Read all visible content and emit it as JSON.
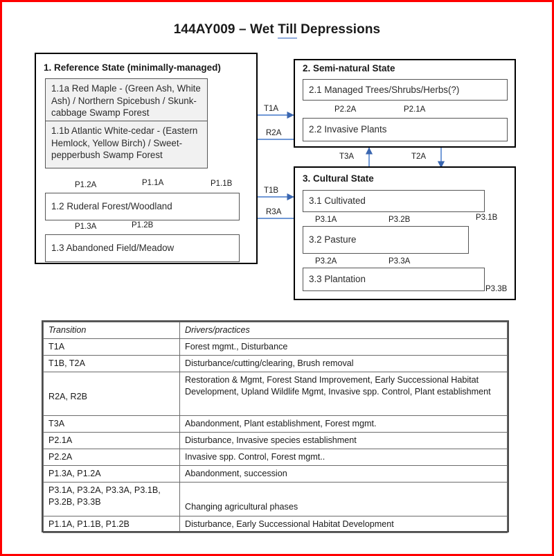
{
  "page": {
    "title_prefix": "144AY009 – Wet ",
    "title_misspelled": "Till",
    "title_suffix": " Depressions",
    "frame_color": "#FF0000",
    "arrow_color": "#4472C4"
  },
  "states": [
    {
      "id": "state-1",
      "title": "1.  Reference State (minimally-managed)",
      "phases": [
        {
          "id": "1.1a",
          "label": "1.1a Red Maple - (Green Ash, White Ash) / Northern Spicebush / Skunk-cabbage Swamp Forest"
        },
        {
          "id": "1.1b",
          "label": "1.1b Atlantic White-cedar - (Eastern Hemlock, Yellow Birch) / Sweet-pepperbush Swamp Forest"
        },
        {
          "id": "1.2",
          "label": "1.2  Ruderal Forest/Woodland"
        },
        {
          "id": "1.3",
          "label": "1.3  Abandoned Field/Meadow"
        }
      ]
    },
    {
      "id": "state-2",
      "title": "2.  Semi-natural State",
      "phases": [
        {
          "id": "2.1",
          "label": "2.1  Managed Trees/Shrubs/Herbs(?)"
        },
        {
          "id": "2.2",
          "label": "2.2  Invasive Plants"
        }
      ]
    },
    {
      "id": "state-3",
      "title": "3.  Cultural State",
      "phases": [
        {
          "id": "3.1",
          "label": "3.1  Cultivated"
        },
        {
          "id": "3.2",
          "label": "3.2  Pasture"
        },
        {
          "id": "3.3",
          "label": "3.3  Plantation"
        }
      ]
    }
  ],
  "arrow_labels": {
    "p12a": "P1.2A",
    "p11a": "P1.1A",
    "p11b": "P1.1B",
    "p13a": "P1.3A",
    "p12b": "P1.2B",
    "t1a": "T1A",
    "r2a": "R2A",
    "t1b": "T1B",
    "r3a": "R3A",
    "p22a": "P2.2A",
    "p21a": "P2.1A",
    "t3a": "T3A",
    "t2a": "T2A",
    "p31a": "P3.1A",
    "p32b": "P3.2B",
    "p31b": "P3.1B",
    "p32a": "P3.2A",
    "p33a": "P3.3A",
    "p33b": "P3.3B"
  },
  "table": {
    "headers": [
      "Transition",
      "Drivers/practices"
    ],
    "rows": [
      {
        "transition": "T1A",
        "drivers": "Forest mgmt., Disturbance"
      },
      {
        "transition": "T1B, T2A",
        "drivers": "Disturbance/cutting/clearing, Brush removal"
      },
      {
        "transition": "R2A, R2B",
        "drivers": "Restoration & Mgmt, Forest Stand Improvement, Early Successional Habitat Development, Upland Wildlife Mgmt, Invasive spp. Control, Plant establishment"
      },
      {
        "transition": "T3A",
        "drivers": "Abandonment, Plant establishment, Forest mgmt."
      },
      {
        "transition": "P2.1A",
        "drivers": "Disturbance, Invasive species establishment"
      },
      {
        "transition": "P2.2A",
        "drivers": "Invasive spp. Control, Forest mgmt.."
      },
      {
        "transition": "P1.3A, P1.2A",
        "drivers": "Abandonment, succession"
      },
      {
        "transition": "P3.1A, P3.2A, P3.3A, P3.1B, P3.2B, P3.3B",
        "drivers": "Changing agricultural phases"
      },
      {
        "transition": "P1.1A, P1.1B, P1.2B",
        "drivers": "Disturbance, Early Successional Habitat Development"
      }
    ]
  }
}
